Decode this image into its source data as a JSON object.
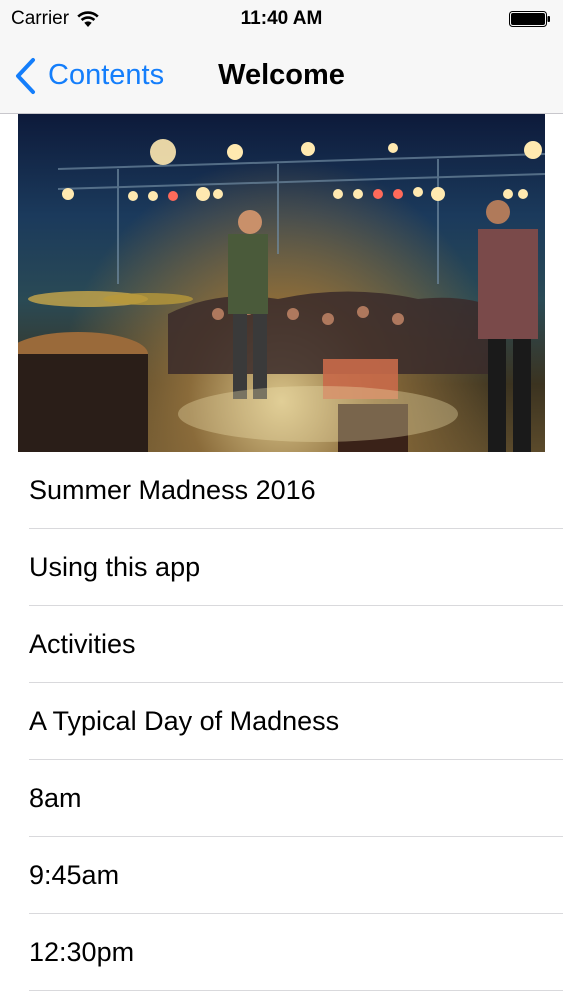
{
  "status_bar": {
    "carrier": "Carrier",
    "time": "11:40 AM",
    "wifi_icon": "wifi-icon",
    "battery_icon": "battery-full-icon"
  },
  "nav": {
    "back_label": "Contents",
    "back_icon": "chevron-left-icon",
    "title": "Welcome",
    "tint_color": "#147efb"
  },
  "hero": {
    "description_icon": "concert-stage-photo"
  },
  "list": {
    "items": [
      {
        "label": "Summer Madness 2016"
      },
      {
        "label": "Using this app"
      },
      {
        "label": "Activities"
      },
      {
        "label": "A Typical Day of Madness"
      },
      {
        "label": "8am"
      },
      {
        "label": "9:45am"
      },
      {
        "label": "12:30pm"
      }
    ]
  }
}
